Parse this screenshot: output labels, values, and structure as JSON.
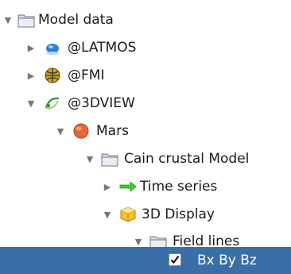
{
  "tree": {
    "root": {
      "label": "Model data",
      "icon": "folder-icon",
      "expanded": true
    },
    "latmos": {
      "label": "@LATMOS",
      "icon": "blue-planet-icon",
      "expanded": false
    },
    "fmi": {
      "label": "@FMI",
      "icon": "globe-icon",
      "expanded": false
    },
    "threedview": {
      "label": "@3DVIEW",
      "icon": "orbit-icon",
      "expanded": true
    },
    "mars": {
      "label": "Mars",
      "icon": "mars-planet-icon",
      "expanded": true
    },
    "cain": {
      "label": "Cain crustal Model",
      "icon": "folder-icon",
      "expanded": true
    },
    "timeseries": {
      "label": "Time series",
      "icon": "green-arrow-icon",
      "expanded": false
    },
    "display3d": {
      "label": "3D Display",
      "icon": "cube-icon",
      "expanded": true
    },
    "fieldlines": {
      "label": "Field lines",
      "icon": "folder-icon",
      "expanded": true
    },
    "bxbybz": {
      "label": "Bx By Bz",
      "checked": true,
      "selected": true
    }
  },
  "colors": {
    "selection": "#3a6ea8",
    "folder": "#cfd8e3",
    "mars": "#e0693a"
  }
}
